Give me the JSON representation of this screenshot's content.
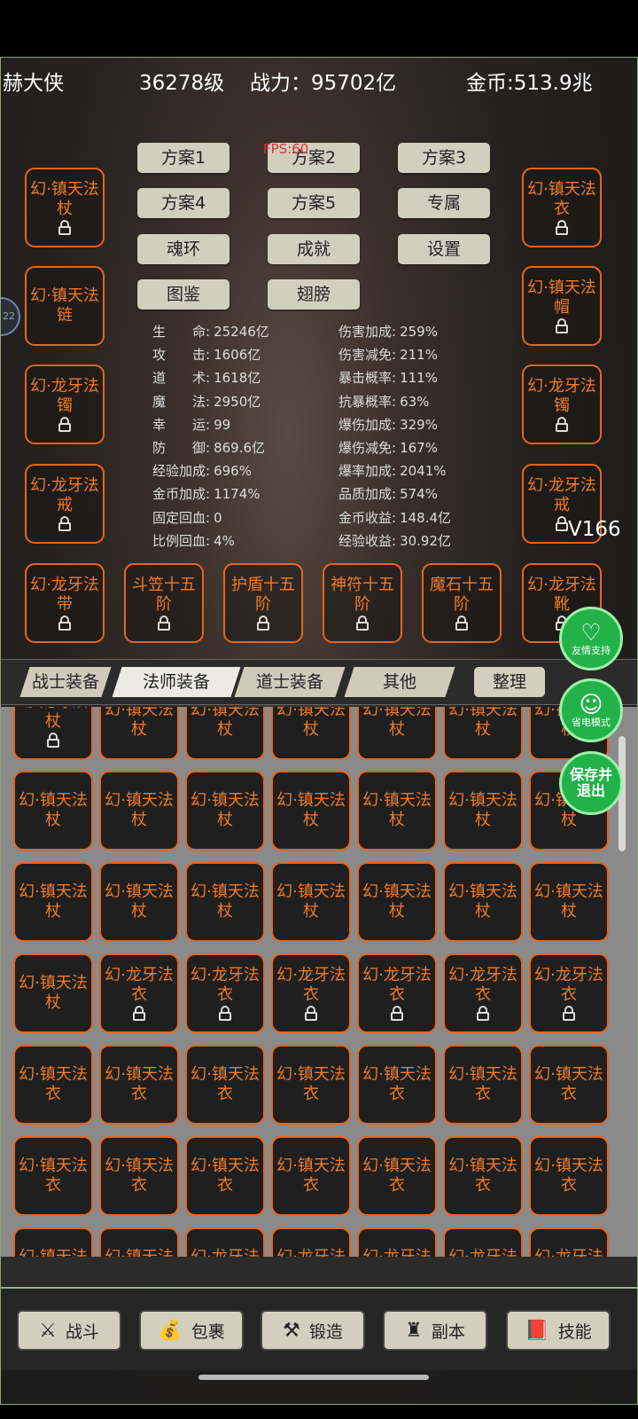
{
  "header": {
    "name": "赫大侠",
    "level": "36278级",
    "power": "战力：95702亿",
    "gold": "金币:513.9兆"
  },
  "fps": "FPS:60",
  "version": "V166",
  "plans": [
    "方案1",
    "方案2",
    "方案3",
    "方案4",
    "方案5",
    "专属",
    "魂环",
    "成就",
    "设置",
    "图鉴",
    "翅膀"
  ],
  "equip_left": [
    {
      "name": "幻·镇天法杖",
      "locked": true
    },
    {
      "name": "幻·镇天法链",
      "locked": false
    },
    {
      "name": "幻·龙牙法镯",
      "locked": true
    },
    {
      "name": "幻·龙牙法戒",
      "locked": true
    },
    {
      "name": "幻·龙牙法带",
      "locked": true
    }
  ],
  "equip_right": [
    {
      "name": "幻·镇天法衣",
      "locked": true
    },
    {
      "name": "幻·镇天法帽",
      "locked": true
    },
    {
      "name": "幻·龙牙法镯",
      "locked": true
    },
    {
      "name": "幻·龙牙法戒",
      "locked": true
    },
    {
      "name": "幻·龙牙法靴",
      "locked": true
    }
  ],
  "equip_bottom": [
    {
      "name": "斗笠十五阶",
      "locked": true
    },
    {
      "name": "护盾十五阶",
      "locked": true
    },
    {
      "name": "神符十五阶",
      "locked": true
    },
    {
      "name": "魔石十五阶",
      "locked": true
    }
  ],
  "stats_left": [
    {
      "k": "生　　命:",
      "v": "25246亿"
    },
    {
      "k": "攻　　击:",
      "v": "1606亿"
    },
    {
      "k": "道　　术:",
      "v": "1618亿"
    },
    {
      "k": "魔　　法:",
      "v": "2950亿"
    },
    {
      "k": "幸　　运:",
      "v": "99"
    },
    {
      "k": "防　　御:",
      "v": "869.6亿"
    },
    {
      "k": "经验加成:",
      "v": "696%"
    },
    {
      "k": "金币加成:",
      "v": "1174%"
    },
    {
      "k": "固定回血:",
      "v": "0"
    },
    {
      "k": "比例回血:",
      "v": "4%"
    }
  ],
  "stats_right": [
    {
      "k": "伤害加成:",
      "v": "259%"
    },
    {
      "k": "伤害减免:",
      "v": "211%"
    },
    {
      "k": "暴击概率:",
      "v": "111%"
    },
    {
      "k": "抗暴概率:",
      "v": "63%"
    },
    {
      "k": "爆伤加成:",
      "v": "329%"
    },
    {
      "k": "爆伤减免:",
      "v": "167%"
    },
    {
      "k": "爆率加成:",
      "v": "2041%"
    },
    {
      "k": "品质加成:",
      "v": "574%"
    },
    {
      "k": "金币收益:",
      "v": "148.4亿"
    },
    {
      "k": "经验收益:",
      "v": "30.92亿"
    }
  ],
  "tabs": [
    "战士装备",
    "法师装备",
    "道士装备",
    "其他",
    "整理"
  ],
  "bag_rows": [
    [
      {
        "n": "幻·龙牙法杖",
        "l": true
      },
      {
        "n": "幻·镇天法杖",
        "l": false
      },
      {
        "n": "幻·镇天法杖",
        "l": false
      },
      {
        "n": "幻·镇天法杖",
        "l": false
      },
      {
        "n": "幻·镇天法杖",
        "l": false
      },
      {
        "n": "幻·镇天法杖",
        "l": false
      },
      {
        "n": "幻·镇天法杖",
        "l": false
      }
    ],
    [
      {
        "n": "幻·镇天法杖",
        "l": false
      },
      {
        "n": "幻·镇天法杖",
        "l": false
      },
      {
        "n": "幻·镇天法杖",
        "l": false
      },
      {
        "n": "幻·镇天法杖",
        "l": false
      },
      {
        "n": "幻·镇天法杖",
        "l": false
      },
      {
        "n": "幻·镇天法杖",
        "l": false
      },
      {
        "n": "幻·镇天法杖",
        "l": false
      }
    ],
    [
      {
        "n": "幻·镇天法杖",
        "l": false
      },
      {
        "n": "幻·镇天法杖",
        "l": false
      },
      {
        "n": "幻·镇天法杖",
        "l": false
      },
      {
        "n": "幻·镇天法杖",
        "l": false
      },
      {
        "n": "幻·镇天法杖",
        "l": false
      },
      {
        "n": "幻·镇天法杖",
        "l": false
      },
      {
        "n": "幻·镇天法杖",
        "l": false
      }
    ],
    [
      {
        "n": "幻·镇天法杖",
        "l": false
      },
      {
        "n": "幻·龙牙法衣",
        "l": true
      },
      {
        "n": "幻·龙牙法衣",
        "l": true
      },
      {
        "n": "幻·龙牙法衣",
        "l": true
      },
      {
        "n": "幻·龙牙法衣",
        "l": true
      },
      {
        "n": "幻·龙牙法衣",
        "l": true
      },
      {
        "n": "幻·龙牙法衣",
        "l": true
      }
    ],
    [
      {
        "n": "幻·镇天法衣",
        "l": false
      },
      {
        "n": "幻·镇天法衣",
        "l": false
      },
      {
        "n": "幻·镇天法衣",
        "l": false
      },
      {
        "n": "幻·镇天法衣",
        "l": false
      },
      {
        "n": "幻·镇天法衣",
        "l": false
      },
      {
        "n": "幻·镇天法衣",
        "l": false
      },
      {
        "n": "幻·镇天法衣",
        "l": false
      }
    ],
    [
      {
        "n": "幻·镇天法衣",
        "l": false
      },
      {
        "n": "幻·镇天法衣",
        "l": false
      },
      {
        "n": "幻·镇天法衣",
        "l": false
      },
      {
        "n": "幻·镇天法衣",
        "l": false
      },
      {
        "n": "幻·镇天法衣",
        "l": false
      },
      {
        "n": "幻·镇天法衣",
        "l": false
      },
      {
        "n": "幻·镇天法衣",
        "l": false
      }
    ],
    [
      {
        "n": "幻·镇天法衣",
        "l": false
      },
      {
        "n": "幻·镇天法衣",
        "l": false
      },
      {
        "n": "幻·龙牙法衣",
        "l": false
      },
      {
        "n": "幻·龙牙法衣",
        "l": false
      },
      {
        "n": "幻·龙牙法衣",
        "l": false
      },
      {
        "n": "幻·龙牙法衣",
        "l": false
      },
      {
        "n": "幻·龙牙法衣",
        "l": false
      }
    ]
  ],
  "fabs": {
    "support": "友情支持",
    "power_save": "省电模式",
    "save_exit": "保存并退出"
  },
  "nav": [
    {
      "label": "战斗",
      "icon": "swords-icon",
      "glyph": "⚔"
    },
    {
      "label": "包裹",
      "icon": "bag-icon",
      "glyph": "💰"
    },
    {
      "label": "锻造",
      "icon": "hammer-icon",
      "glyph": "⚒"
    },
    {
      "label": "副本",
      "icon": "tower-icon",
      "glyph": "♜"
    },
    {
      "label": "技能",
      "icon": "book-icon",
      "glyph": "📕"
    }
  ],
  "colors": {
    "item_border": "#e8651c",
    "item_text": "#f07a26",
    "button_bg": "#d3cfbf",
    "fab_green": "#23b24a"
  }
}
